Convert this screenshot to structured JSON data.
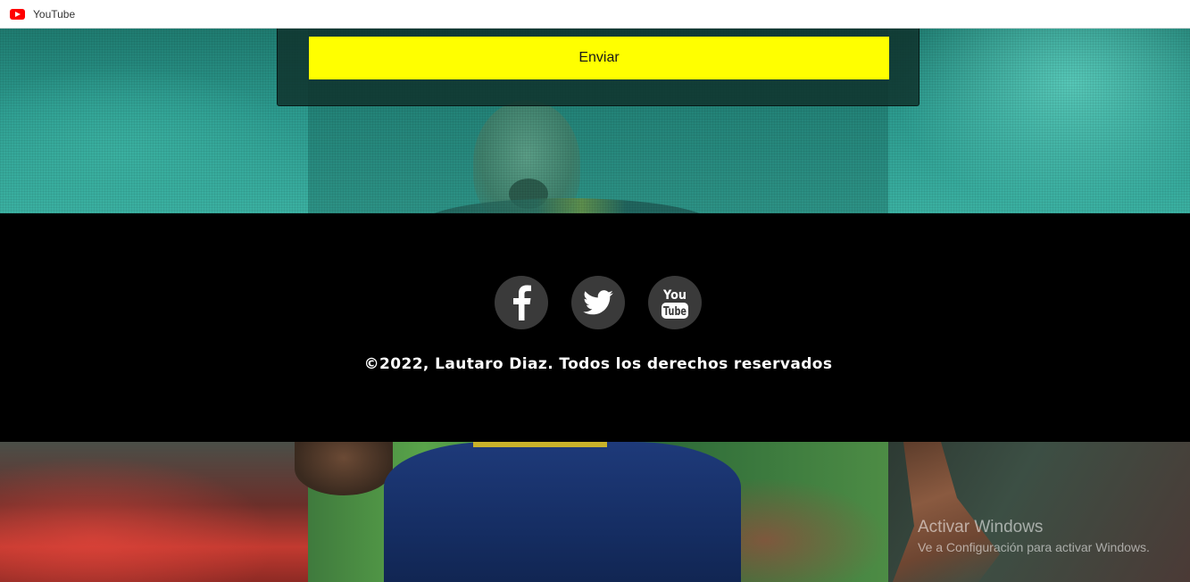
{
  "tab": {
    "title": "YouTube",
    "icon": "youtube-logo-icon"
  },
  "form": {
    "submit_label": "Enviar",
    "submit_color": "#ffff00"
  },
  "footer": {
    "social": [
      {
        "name": "facebook",
        "icon": "facebook-icon"
      },
      {
        "name": "twitter",
        "icon": "twitter-icon"
      },
      {
        "name": "youtube",
        "icon": "youtube-icon",
        "text_top": "You",
        "text_bottom": "Tube"
      }
    ],
    "copyright": "©2022, Lautaro Diaz. Todos los derechos reservados",
    "background": "#000000",
    "icon_bg": "#3a3a3a"
  },
  "watermark": {
    "title": "Activar Windows",
    "subtitle": "Ve a Configuración para activar Windows."
  }
}
